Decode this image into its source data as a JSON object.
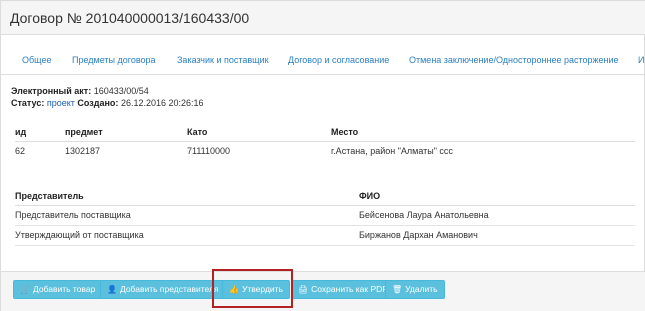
{
  "header": {
    "title": "Договор № 201040000013/160433/00"
  },
  "tabs": [
    {
      "label": "Общее"
    },
    {
      "label": "Предметы договора"
    },
    {
      "label": "Заказчик и поставщик"
    },
    {
      "label": "Договор и согласование"
    },
    {
      "label": "Отмена заключение/Одностороннее расторжение"
    },
    {
      "label": "И"
    }
  ],
  "act": {
    "label": "Электронный акт:",
    "value": "160433/00/54",
    "status_label": "Статус:",
    "status_value": "проект",
    "created_label": "Создано:",
    "created_value": "26.12.2016 20:26:16"
  },
  "items_table": {
    "headers": [
      "ид",
      "предмет",
      "Като",
      "Место"
    ],
    "rows": [
      [
        "62",
        "1302187",
        "711110000",
        "г.Астана, район \"Алматы\" ссс"
      ]
    ]
  },
  "reps_table": {
    "headers": [
      "Представитель",
      "ФИО"
    ],
    "rows": [
      [
        "Представитель поставщика",
        "Бейсенова Лаура Анатольевна"
      ],
      [
        "Утверждающий от поставщика",
        "Биржанов Дархан Аманович"
      ]
    ]
  },
  "toolbar": {
    "add_item": "Добавить товар",
    "add_rep": "Добавить представителя",
    "approve": "Утвердить",
    "save_pdf": "Сохранить как PDF",
    "delete": "Удалить"
  },
  "colors": {
    "button_bg": "#5bc0de",
    "tab_link": "#2a7fc1",
    "status_link": "#1a5fb4",
    "highlight": "#b22222"
  }
}
